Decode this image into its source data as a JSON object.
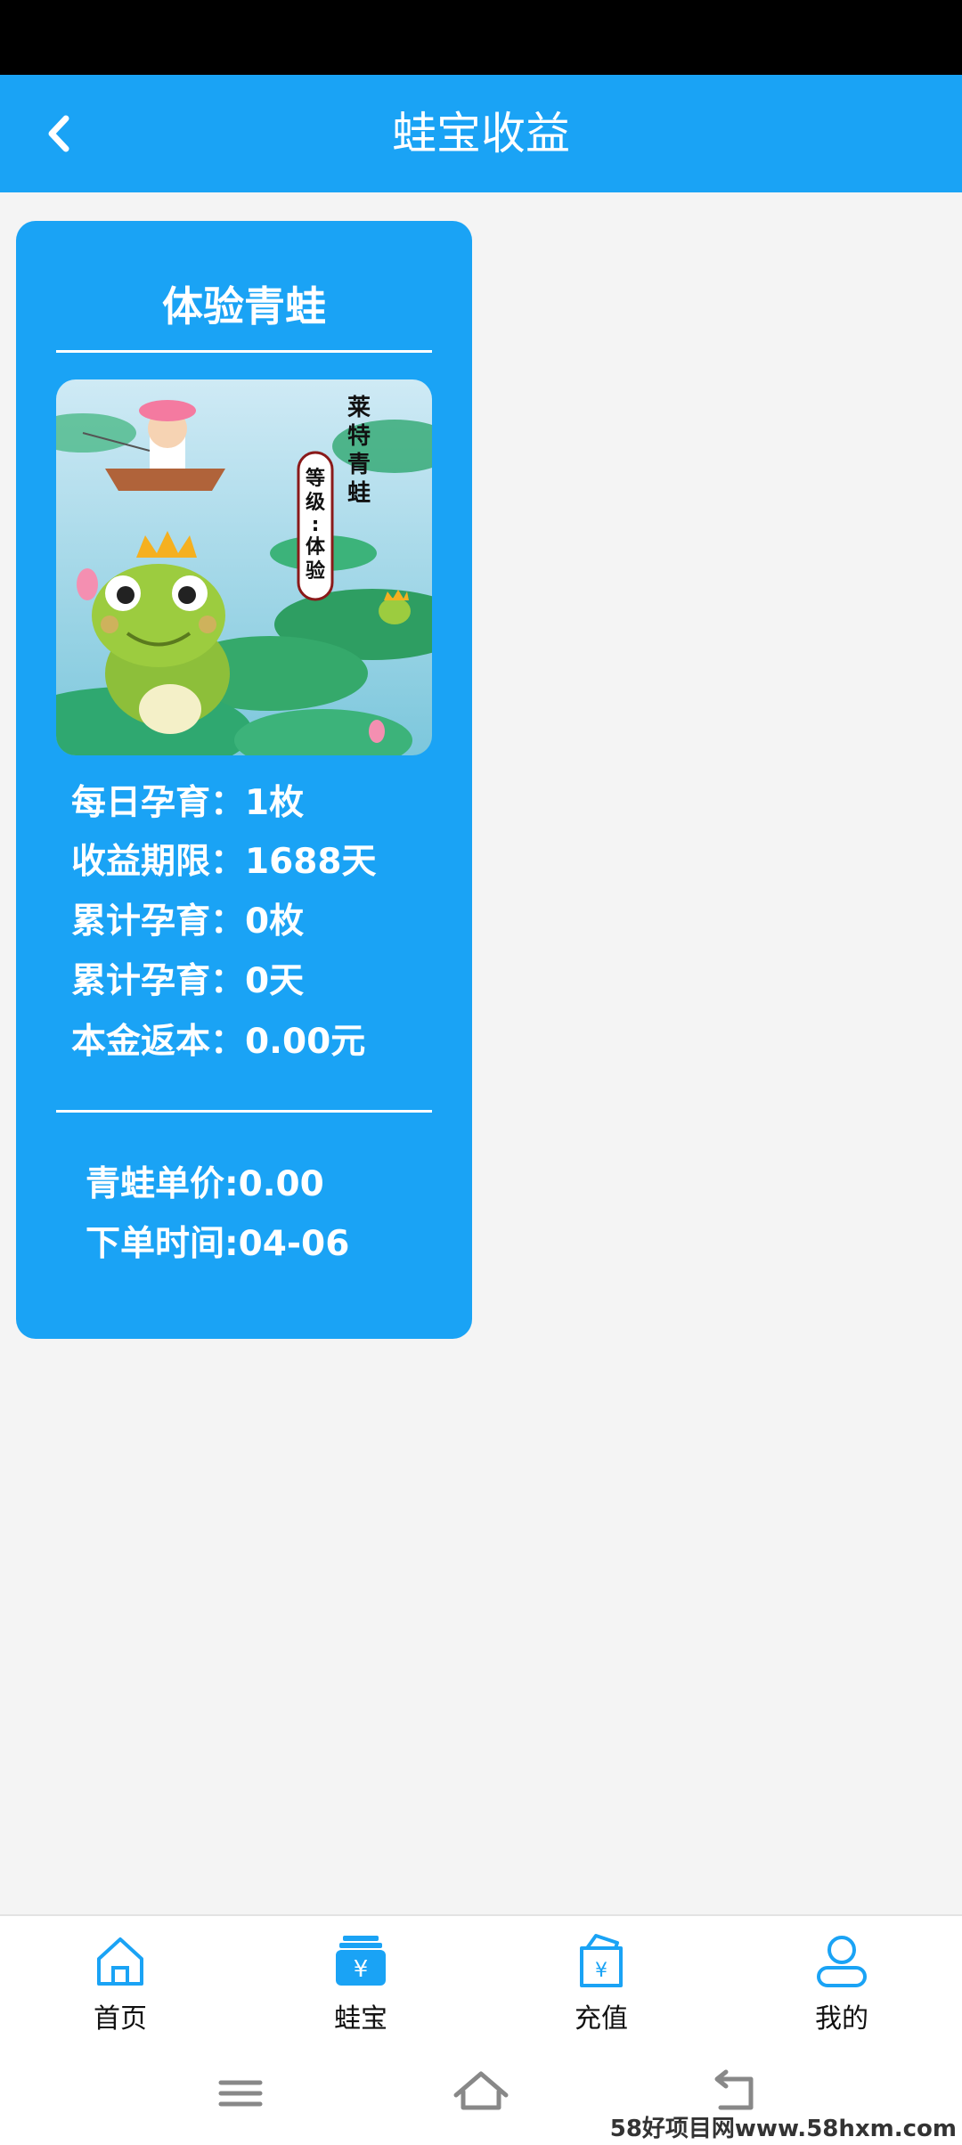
{
  "header": {
    "title": "蛙宝收益"
  },
  "card": {
    "title": "体验青蛙",
    "image": {
      "brand_text": "莱特青蛙",
      "level_text": "等级：体验"
    },
    "stats": [
      {
        "label": "每日孕育：",
        "value": "1枚"
      },
      {
        "label": "收益期限：",
        "value": "1688天"
      },
      {
        "label": "累计孕育：",
        "value": "0枚"
      },
      {
        "label": "累计孕育：",
        "value": "0天"
      },
      {
        "label": "本金返本：",
        "value": "0.00元"
      }
    ],
    "order": {
      "price": "青蛙单价:0.00",
      "time": "下单时间:04-06"
    }
  },
  "tabs": [
    {
      "label": "首页",
      "icon": "home-icon"
    },
    {
      "label": "蛙宝",
      "icon": "wallet-icon",
      "active": true
    },
    {
      "label": "充值",
      "icon": "recharge-icon"
    },
    {
      "label": "我的",
      "icon": "profile-icon"
    }
  ],
  "watermark": "58好项目网www.58hxm.com",
  "colors": {
    "primary": "#1aa3f5",
    "background": "#f4f4f4"
  }
}
